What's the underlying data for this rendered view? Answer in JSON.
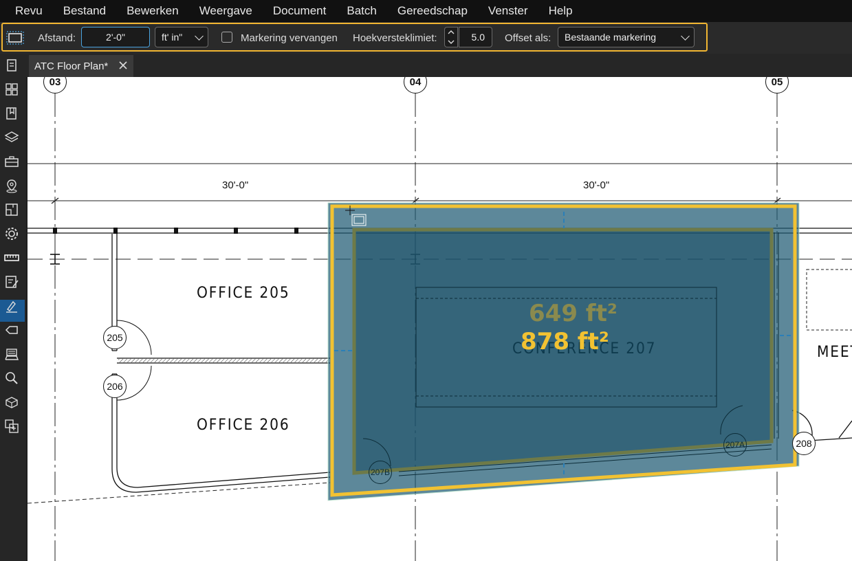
{
  "menu": [
    "Revu",
    "Bestand",
    "Bewerken",
    "Weergave",
    "Document",
    "Batch",
    "Gereedschap",
    "Venster",
    "Help"
  ],
  "toolbar": {
    "distance_label": "Afstand:",
    "distance_value": "2'-0\"",
    "unit_value": "ft' in\"",
    "replace_markup_label": "Markering vervangen",
    "replace_markup_checked": false,
    "angle_limit_label": "Hoekversteklimiet:",
    "angle_limit_value": "5.0",
    "offset_label": "Offset als:",
    "offset_value": "Bestaande markering",
    "accent_color": "#f2b632"
  },
  "tab": {
    "title": "ATC Floor Plan*"
  },
  "left_tools": [
    "pages-icon",
    "thumbnails-icon",
    "bookmarks-icon",
    "layers-icon",
    "toolchest-icon",
    "places-icon",
    "spaces-icon",
    "properties-icon",
    "measurements-icon",
    "markups-list-icon",
    "signatures-icon",
    "tags-icon",
    "stamps-icon",
    "search-icon",
    "3d-icon",
    "compare-icon"
  ],
  "drawing": {
    "grid_lines": [
      "03",
      "04",
      "05"
    ],
    "dimensions": [
      "30'-0\"",
      "30'-0\""
    ],
    "rooms": [
      "OFFICE 205",
      "OFFICE 206",
      "CONFERENCE 207",
      "MEET"
    ],
    "door_tags": [
      "205",
      "206",
      "207B",
      "207A",
      "208"
    ],
    "areas": {
      "inner": "649 ft²",
      "outer": "878 ft²",
      "inner_color": "#8a8a4e",
      "outer_color": "#f2c232",
      "fill_color": "#1f5a73"
    }
  }
}
